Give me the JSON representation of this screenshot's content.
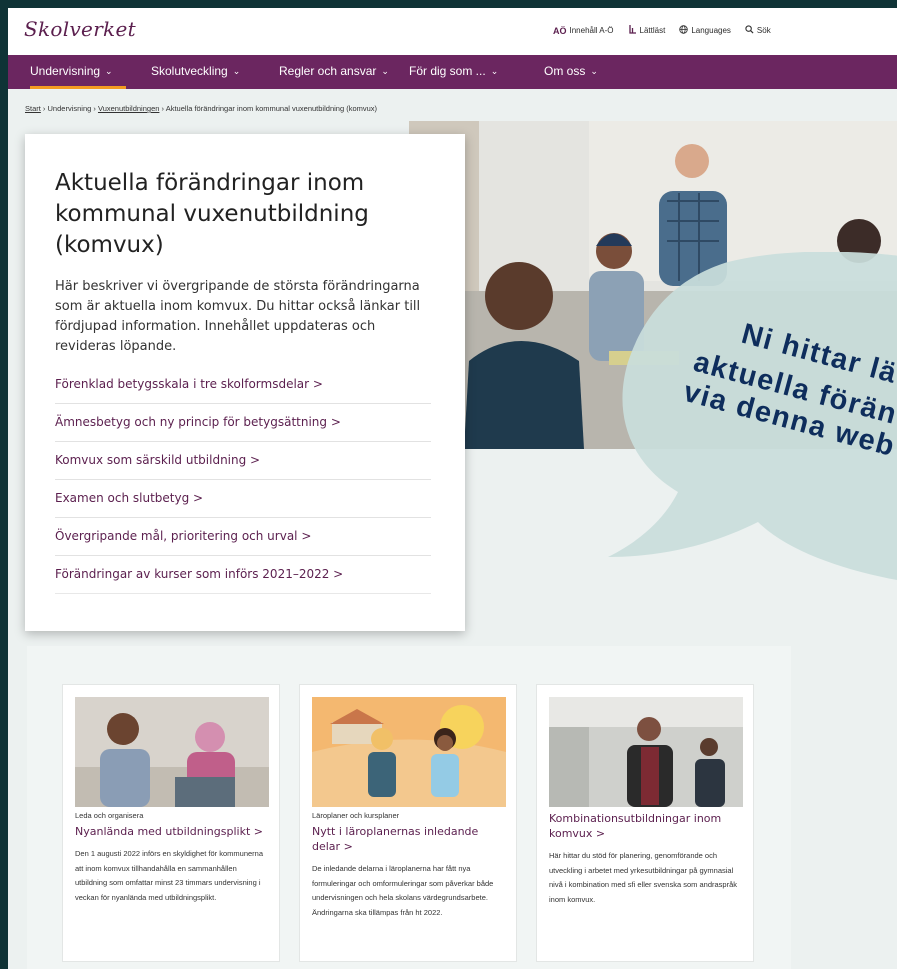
{
  "header": {
    "logo": "Skolverket",
    "utility": [
      {
        "icon": "AÖ",
        "label": "Innehåll A-Ö"
      },
      {
        "icon": "ꟷ",
        "label": "Lättläst"
      },
      {
        "icon": "⊕",
        "label": "Languages"
      },
      {
        "icon": "⌕",
        "label": "Sök"
      }
    ]
  },
  "nav": {
    "items": [
      {
        "label": "Undervisning"
      },
      {
        "label": "Skolutveckling"
      },
      {
        "label": "Regler och ansvar"
      },
      {
        "label": "För dig som ..."
      },
      {
        "label": "Om oss"
      }
    ],
    "chevron": "⌄",
    "accent": "#f29b21"
  },
  "breadcrumb": {
    "start": "Start",
    "sep": " › ",
    "level1": "Undervisning",
    "level2": "Vuxenutbildningen",
    "current": "Aktuella förändringar inom kommunal vuxenutbildning (komvux)"
  },
  "main": {
    "title": "Aktuella förändringar inom kommunal vuxenutbildning (komvux)",
    "intro": "Här beskriver vi övergripande de största förändringarna som är aktuella inom komvux. Du hittar också länkar till fördjupad information. Innehållet uppdateras och revideras löpande.",
    "links": [
      "Förenklad betygsskala i tre skolformsdelar >",
      "Ämnesbetyg och ny princip för betygsättning >",
      "Komvux som särskild utbildning >",
      "Examen och slutbetyg >",
      "Övergripande mål, prioritering och urval >",
      "Förändringar av kurser som införs 2021–2022 >"
    ]
  },
  "bubble": {
    "lines": [
      "Ni hittar lä",
      "aktuella förän",
      "via denna web"
    ],
    "color": "#c9dedb"
  },
  "tiles": [
    {
      "category": "Leda och organisera",
      "title": "Nyanlända med utbildningsplikt  >",
      "desc": "Den 1 augusti 2022 införs en skyldighet för kommunerna att inom komvux tillhandahålla en sammanhållen utbildning som omfattar minst 23 timmars undervisning i veckan för nyanlända med utbildningsplikt."
    },
    {
      "category": "Läroplaner och kursplaner",
      "title": "Nytt i läroplanernas inledande delar >",
      "desc": "De inledande delarna i läroplanerna har fått nya formuleringar och omformuleringar som påverkar både undervisningen och hela skolans värdegrundsarbete. Ändringarna ska tillämpas från ht 2022."
    },
    {
      "category": "",
      "title": "Kombinationsutbildningar inom komvux  >",
      "desc": "Här hittar du stöd för planering, genomförande och utveckling i arbetet med yrkesutbildningar på gymnasial nivå i kombination med sfi eller svenska som andraspråk inom komvux."
    }
  ]
}
